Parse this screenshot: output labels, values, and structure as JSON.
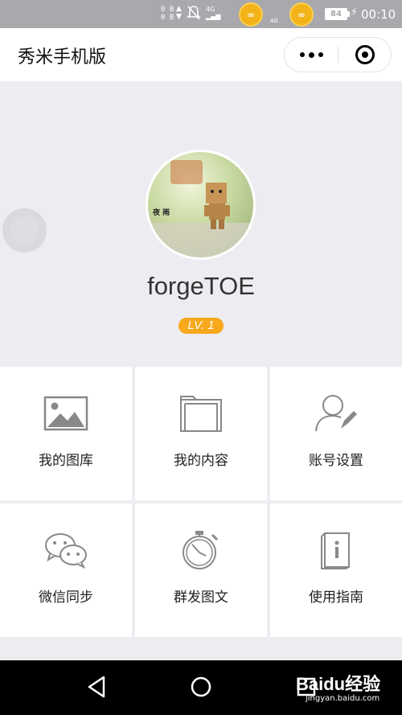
{
  "status_bar": {
    "net_up": "0 B",
    "net_down": "0 B",
    "signal_label": "4G",
    "network_label": "4G",
    "coin_label": "∞",
    "battery": "84",
    "time": "00:10"
  },
  "navbar": {
    "title": "秀米手机版"
  },
  "profile": {
    "avatar_caption": "夜 雨",
    "username": "forgeTOE",
    "level": "LV. 1"
  },
  "menu": [
    {
      "label": "我的图库",
      "icon": "image-icon"
    },
    {
      "label": "我的内容",
      "icon": "folder-icon"
    },
    {
      "label": "账号设置",
      "icon": "user-edit-icon"
    },
    {
      "label": "微信同步",
      "icon": "wechat-icon"
    },
    {
      "label": "群发图文",
      "icon": "stopwatch-icon"
    },
    {
      "label": "使用指南",
      "icon": "guide-book-icon"
    }
  ],
  "watermark": {
    "brand": "Baidu经验",
    "url": "jingyan.baidu.com"
  },
  "colors": {
    "level_badge": "#f7a81b",
    "status_bar": "#a9a9ad",
    "page_bg": "#ededf1"
  }
}
